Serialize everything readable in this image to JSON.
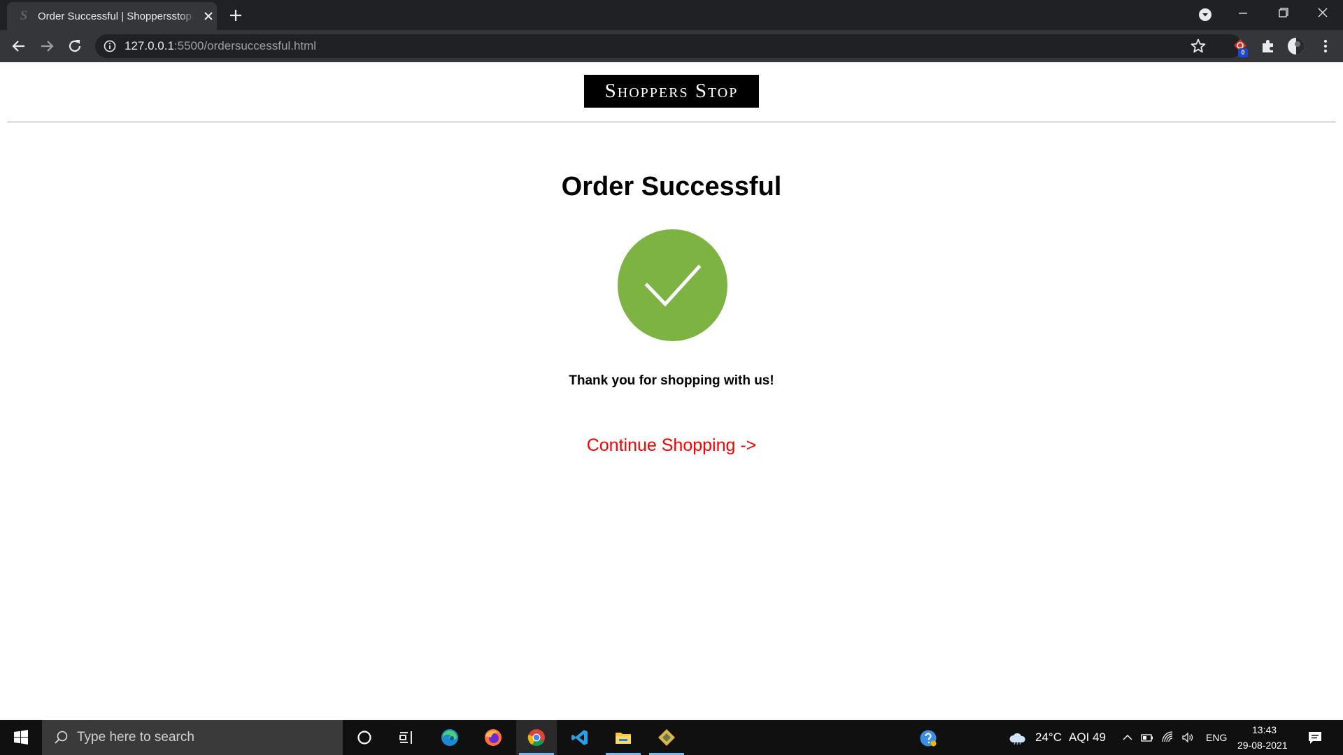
{
  "browser": {
    "tab_title": "Order Successful | Shoppersstop.com",
    "tab_favicon": "S",
    "url_host": "127.0.0.1",
    "url_rest": ":5500/ordersuccessful.html",
    "extension_badge": "0",
    "icons": [
      "back-icon",
      "forward-icon",
      "reload-icon",
      "info-icon",
      "star-icon",
      "extension-icon",
      "puzzle-icon",
      "profile-icon",
      "menu-icon"
    ]
  },
  "page": {
    "logo_text": "Shoppers Stop",
    "title": "Order Successful",
    "thanks_text": "Thank you for shopping with us!",
    "continue_label": "Continue Shopping ->"
  },
  "taskbar": {
    "search_placeholder": "Type here to search",
    "weather": "24°C",
    "aqi": "AQI 49",
    "language": "ENG",
    "time": "13:43",
    "date": "29-08-2021"
  },
  "colors": {
    "check_green": "#7cb342",
    "continue_red": "#ff0000",
    "chrome_dark": "#202124",
    "chrome_toolbar": "#35363a"
  }
}
